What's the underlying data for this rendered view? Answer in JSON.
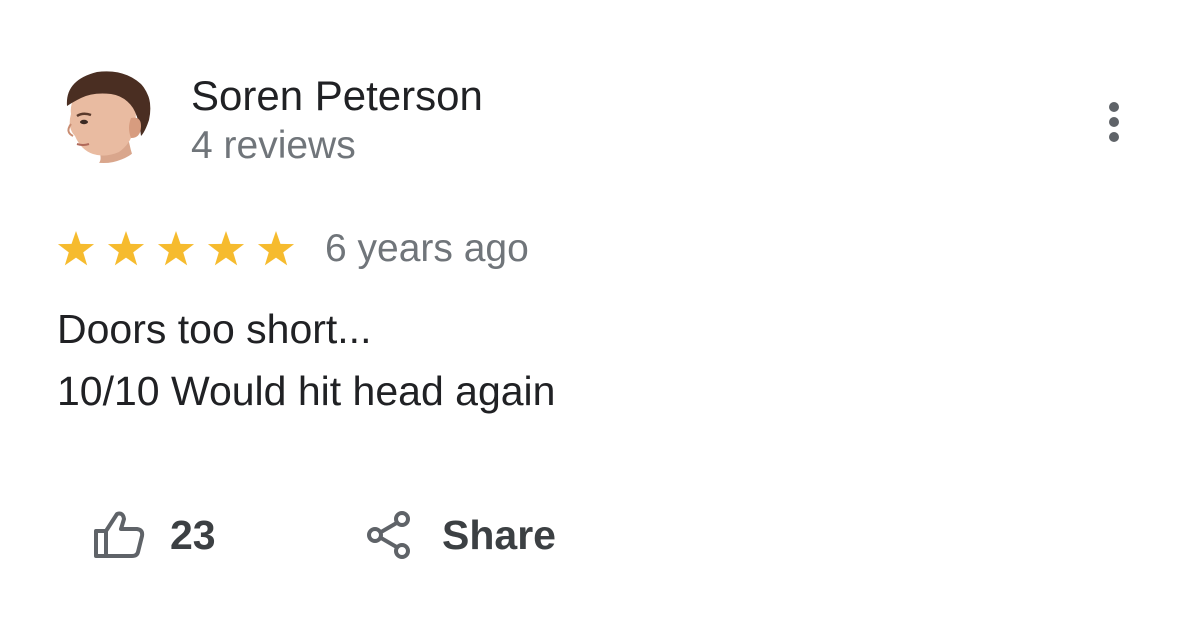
{
  "review": {
    "author": {
      "name": "Soren Peterson",
      "review_count": "4 reviews",
      "avatar_icon": "profile-photo"
    },
    "rating": 5,
    "rating_max": 5,
    "date": "6 years ago",
    "text_lines": [
      "Doors too short...",
      "10/10 Would hit head again"
    ],
    "actions": {
      "like_icon": "thumb-up-icon",
      "like_count": "23",
      "share_icon": "share-icon",
      "share_label": "Share",
      "more_icon": "more-vert-icon"
    }
  },
  "colors": {
    "star": "#f6bb2e",
    "primary_text": "#202124",
    "secondary_text": "#70757a",
    "action_text": "#3c4043",
    "icon": "#5f6368"
  }
}
